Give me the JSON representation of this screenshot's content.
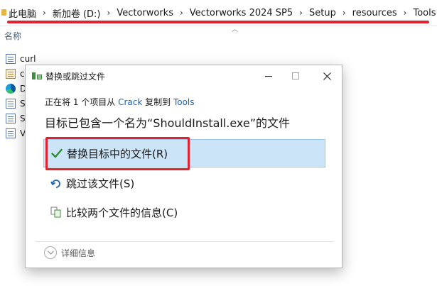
{
  "address_bar": {
    "crumbs": [
      "此电脑",
      "新加卷 (D:)",
      "Vectorworks",
      "Vectorworks 2024 SP5",
      "Setup",
      "resources",
      "Tools"
    ],
    "separator": "›"
  },
  "explorer": {
    "column_header": "名称",
    "files": [
      {
        "name": "curl",
        "icon": "document-icon"
      },
      {
        "name": "c",
        "icon": "config-file-icon"
      },
      {
        "name": "D",
        "icon": "edge-browser-icon"
      },
      {
        "name": "S",
        "icon": "document-icon"
      },
      {
        "name": "S",
        "icon": "document-icon"
      },
      {
        "name": "V",
        "icon": "document-icon"
      }
    ]
  },
  "dialog": {
    "title": "替换或跳过文件",
    "progress_prefix": "正在将 1 个项目从 ",
    "source": "Crack",
    "progress_middle": " 复制到 ",
    "destination": "Tools",
    "headline": "目标已包含一个名为“ShouldInstall.exe”的文件",
    "options": {
      "replace": "替换目标中的文件(R)",
      "skip": "跳过该文件(S)",
      "compare": "比较两个文件的信息(C)"
    },
    "details": "详细信息"
  },
  "colors": {
    "highlight_bg": "#cce4f7",
    "highlight_border": "#99c9ef",
    "annotation_red": "#e0232e",
    "link_blue": "#1f63b6",
    "check_green": "#2e8b37"
  }
}
